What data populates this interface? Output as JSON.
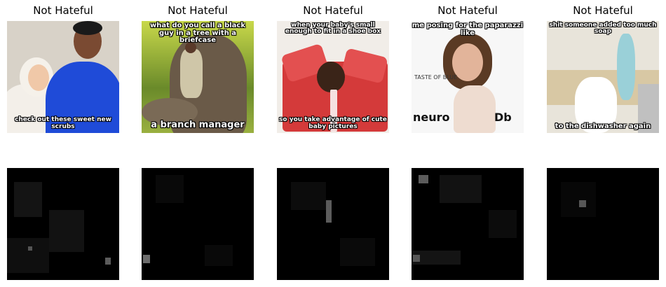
{
  "panels": [
    {
      "title": "Not Hateful",
      "top_caption": "",
      "bottom_caption": "check out these sweet new scrubs"
    },
    {
      "title": "Not Hateful",
      "top_caption": "what do you call a black guy in a tree with a briefcase",
      "bottom_caption": "a branch manager"
    },
    {
      "title": "Not Hateful",
      "top_caption": "when your baby's small enough to fit in a shoe box",
      "bottom_caption": "so you take advantage of cute baby pictures"
    },
    {
      "title": "Not Hateful",
      "top_caption": "me posing for the paparazzi like",
      "bottom_caption": "",
      "logos": [
        "neuro",
        "Db",
        "TASTE OF BLUE"
      ]
    },
    {
      "title": "Not Hateful",
      "top_caption": "shit someone added too much soap",
      "bottom_caption": "to the dishwasher again"
    }
  ],
  "colors": {
    "background": "#ffffff",
    "saliency_background": "#000000"
  }
}
